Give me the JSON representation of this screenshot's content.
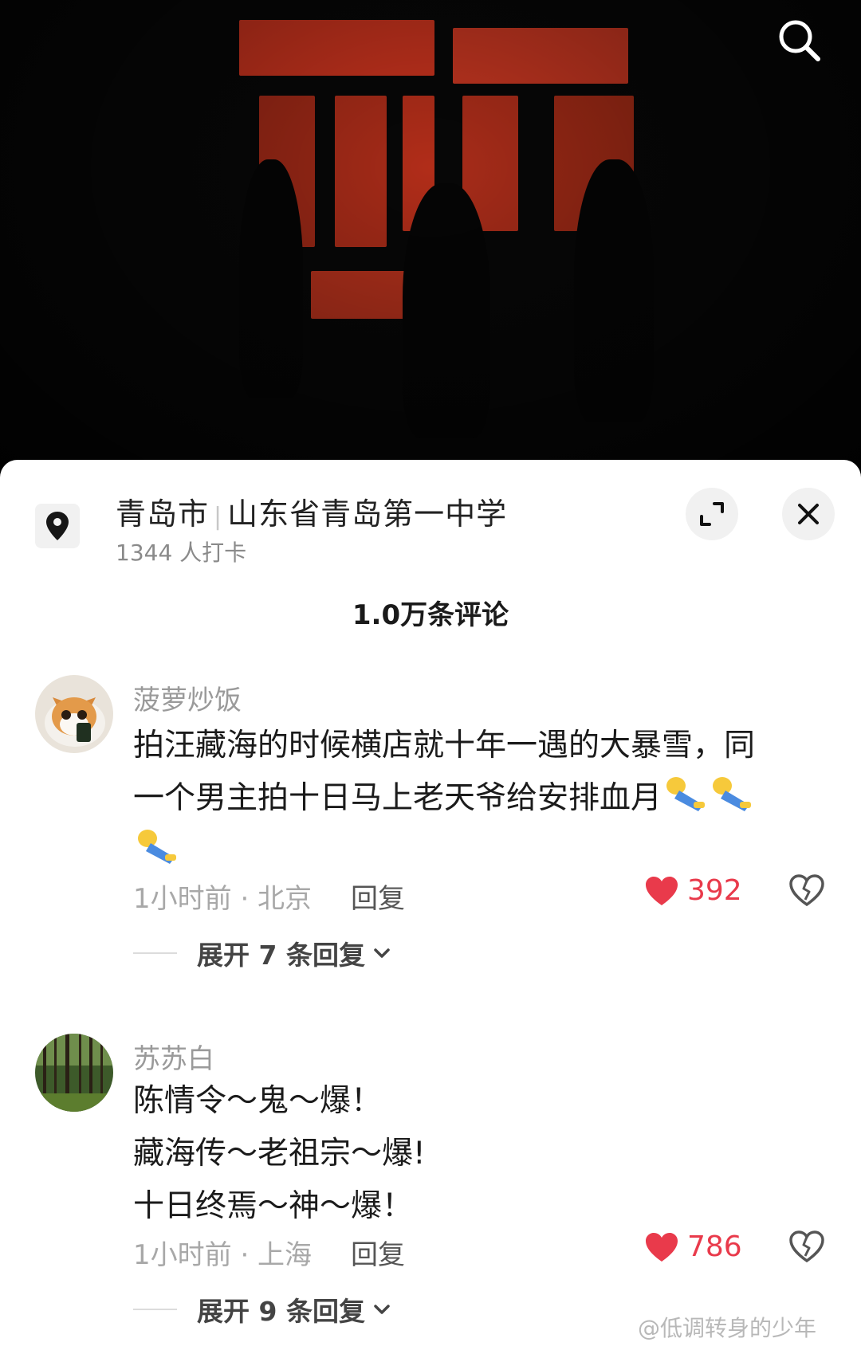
{
  "location": {
    "city": "青岛市",
    "place": "山东省青岛第一中学",
    "checkins": "1344 人打卡"
  },
  "comments_header": "1.0万条评论",
  "comments": [
    {
      "author": "菠萝炒饭",
      "lines": [
        "拍汪藏海的时候横店就十年一遇的大暴雪，同",
        "一个男主拍十日马上老天爷给安排血月"
      ],
      "time_location": "1小时前 · 北京",
      "reply_label": "回复",
      "likes": "392",
      "expand_label": "展开 7 条回复"
    },
    {
      "author": "苏苏白",
      "lines": [
        "陈情令～鬼～爆！",
        "藏海传～老祖宗～爆!",
        "十日终焉～神～爆！"
      ],
      "time_location": "1小时前 · 上海",
      "reply_label": "回复",
      "likes": "786",
      "expand_label": "展开 9 条回复"
    }
  ],
  "watermark": "@低调转身的少年",
  "icons": {
    "search": "search-icon",
    "location": "location-pin-icon",
    "expand": "expand-icon",
    "close": "close-icon",
    "like": "heart-icon",
    "dislike": "broken-heart-icon",
    "expand_replies": "chevron-down-icon"
  },
  "colors": {
    "like": "#e93a4b",
    "video_glow": "#c5321d"
  }
}
